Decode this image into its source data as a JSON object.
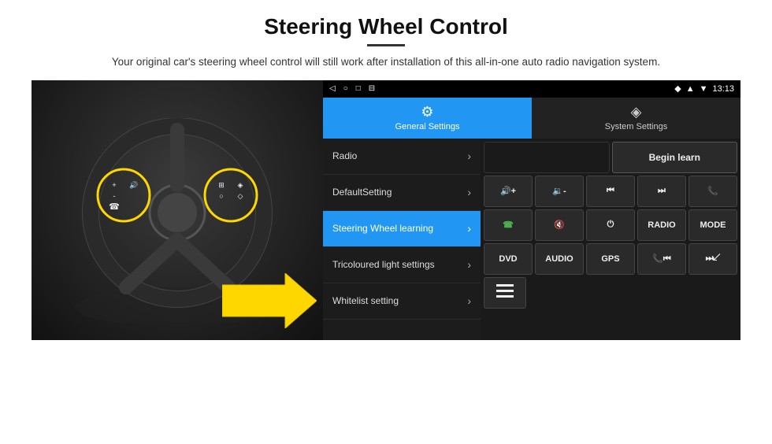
{
  "header": {
    "title": "Steering Wheel Control",
    "subtitle": "Your original car's steering wheel control will still work after installation of this all-in-one auto radio navigation system."
  },
  "status_bar": {
    "nav_back": "◁",
    "nav_home": "○",
    "nav_square": "□",
    "nav_menu": "⊟",
    "signal": "▲",
    "wifi": "▼",
    "time": "13:13"
  },
  "tabs": [
    {
      "id": "general",
      "label": "General Settings",
      "icon": "⚙",
      "active": true
    },
    {
      "id": "system",
      "label": "System Settings",
      "icon": "◈",
      "active": false
    }
  ],
  "menu_items": [
    {
      "id": "radio",
      "label": "Radio",
      "active": false
    },
    {
      "id": "default",
      "label": "DefaultSetting",
      "active": false
    },
    {
      "id": "steering",
      "label": "Steering Wheel learning",
      "active": true
    },
    {
      "id": "tricoloured",
      "label": "Tricoloured light settings",
      "active": false
    },
    {
      "id": "whitelist",
      "label": "Whitelist setting",
      "active": false
    }
  ],
  "button_grid": {
    "row1": [
      {
        "id": "empty1",
        "label": "",
        "type": "empty"
      },
      {
        "id": "begin-learn",
        "label": "Begin learn",
        "type": "begin-learn"
      }
    ],
    "row2": [
      {
        "id": "vol-up",
        "label": "🔊+",
        "type": "icon"
      },
      {
        "id": "vol-down",
        "label": "🔉-",
        "type": "icon"
      },
      {
        "id": "prev-track",
        "label": "⏮",
        "type": "icon"
      },
      {
        "id": "next-track",
        "label": "⏭",
        "type": "icon"
      },
      {
        "id": "phone",
        "label": "📞",
        "type": "icon"
      }
    ],
    "row3": [
      {
        "id": "call-answer",
        "label": "📞",
        "type": "icon-green"
      },
      {
        "id": "mute",
        "label": "🔇",
        "type": "icon"
      },
      {
        "id": "power",
        "label": "⏻",
        "type": "icon"
      },
      {
        "id": "radio-btn",
        "label": "RADIO",
        "type": "text"
      },
      {
        "id": "mode-btn",
        "label": "MODE",
        "type": "text"
      }
    ],
    "row4": [
      {
        "id": "dvd-btn",
        "label": "DVD",
        "type": "text"
      },
      {
        "id": "audio-btn",
        "label": "AUDIO",
        "type": "text"
      },
      {
        "id": "gps-btn",
        "label": "GPS",
        "type": "text"
      },
      {
        "id": "phone2",
        "label": "📞⏮",
        "type": "icon"
      },
      {
        "id": "skip",
        "label": "⏭↙",
        "type": "icon"
      }
    ],
    "row5": [
      {
        "id": "menu-icon",
        "label": "≡",
        "type": "icon-small"
      }
    ]
  }
}
